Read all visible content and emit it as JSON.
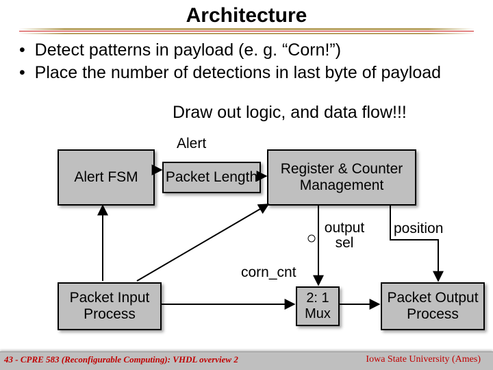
{
  "title": "Architecture",
  "bullets": {
    "b1": "Detect patterns in payload (e. g. “Corn!”)",
    "b2": "Place the number of detections in last byte of payload"
  },
  "annotation": "Draw out logic, and data flow!!!",
  "nodes": {
    "alertFsm": "Alert FSM",
    "packetLength": "Packet Length",
    "regCounter": "Register & Counter Management",
    "mux": "2: 1 Mux",
    "packetIn": "Packet Input Process",
    "packetOut": "Packet Output Process"
  },
  "labels": {
    "alert": "Alert",
    "outputSel": "output sel",
    "position": "position",
    "cornCnt": "corn_cnt"
  },
  "footer": {
    "left": "43 - CPRE 583 (Reconfigurable Computing):  VHDL overview 2",
    "right": "Iowa State University (Ames)"
  }
}
